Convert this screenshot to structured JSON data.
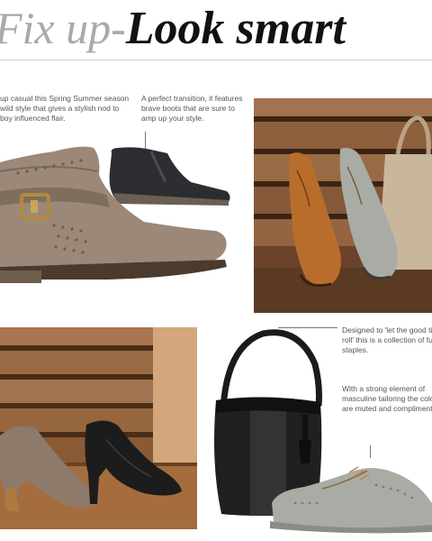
{
  "header": {
    "title_light": "Fix up-",
    "title_dark": "Look smart"
  },
  "captions": {
    "ankle_boots": [
      "up casual this Spring Summer season",
      "wild style that gives a stylish nod to",
      "boy influenced flair."
    ],
    "chelsea_boots": [
      "A perfect transition, it features",
      "brave boots that are sure to",
      "amp up your style."
    ],
    "handbag": [
      "Designed to 'let the good tir",
      "roll' this is a collection of fu",
      "staples."
    ],
    "brogues": [
      "With a strong element of",
      "masculine tailoring the colo",
      "are muted and complimenta"
    ]
  },
  "colors": {
    "title_light": "#a9a9a9",
    "title_dark": "#111111",
    "rule": "#cfcfcf",
    "wood": "#8a5a35",
    "taupe_suede": "#9b8878",
    "tan_leather": "#b86d2b",
    "grey_suede": "#a8aca4",
    "black": "#1c1c1c"
  },
  "icons": [
    "ankle-boot-image",
    "chelsea-boot-image",
    "brogue-pair-image",
    "heeled-sandal-image",
    "hobo-bag-image",
    "grey-brogue-image"
  ]
}
